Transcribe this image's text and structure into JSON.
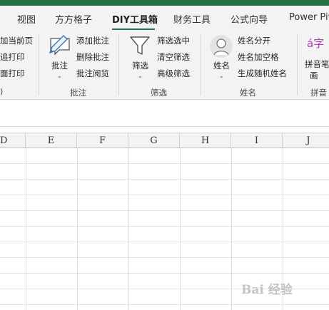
{
  "tabs": [
    "视图",
    "方方格子",
    "DIY工具箱",
    "财务工具",
    "公式向导",
    "Power Piv"
  ],
  "active_tab": "DIY工具箱",
  "ribbon": {
    "left_group": {
      "items": [
        "加当前页",
        "追打印",
        "面打印"
      ]
    },
    "annotation_group": {
      "big_button_label": "批注",
      "items": [
        "添加批注",
        "删除批注",
        "批注阅览"
      ],
      "group_label": "批注"
    },
    "filter_group": {
      "big_button_label": "筛选",
      "items": [
        "筛选选中",
        "清空筛选",
        "高级筛选"
      ],
      "group_label": "筛选"
    },
    "name_group": {
      "big_button_label": "姓名",
      "items": [
        "姓名分开",
        "姓名加空格",
        "生成随机姓名"
      ],
      "group_label": "姓名"
    },
    "pinyin_group": {
      "icon_text": "á字",
      "big_button_label_line1": "拼音笔",
      "big_button_label_line2": "画",
      "group_label": "拼音"
    }
  },
  "columns": [
    "D",
    "E",
    "F",
    "G",
    "H",
    "I",
    "J"
  ],
  "watermark": "Bai 经验"
}
